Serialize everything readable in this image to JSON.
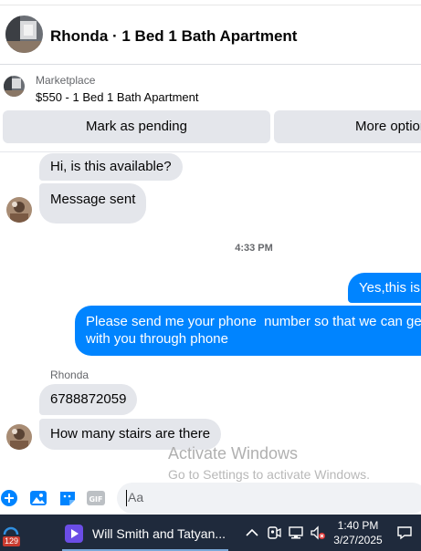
{
  "header": {
    "title": "Rhonda · 1 Bed 1 Bath Apartment"
  },
  "listing": {
    "source": "Marketplace",
    "price_title": "$550 - 1 Bed 1 Bath Apartment"
  },
  "actions": {
    "pending_label": "Mark as pending",
    "more_label": "More options"
  },
  "conversation": {
    "incoming_top": [
      "Hi, is this available?",
      "Message sent"
    ],
    "timestamp": "4:33 PM",
    "outgoing": [
      "Yes,this is still available",
      "Please send me your phone  number so that we can get\nwith you through phone"
    ],
    "sender_name": "Rhonda",
    "incoming_bottom": [
      "6788872059",
      "How many stairs are there"
    ]
  },
  "watermark": {
    "line1": "Activate Windows",
    "line2": "Go to Settings to activate Windows."
  },
  "composer": {
    "placeholder": "Aa",
    "icons": [
      "plus-circle-icon",
      "photo-icon",
      "sticker-icon",
      "gif-icon"
    ]
  },
  "taskbar": {
    "notification_count": "129",
    "app_label": "Will Smith and Tatyan...",
    "time": "1:40 PM",
    "date": "3/27/2025",
    "tray_icons": [
      "chevron-up-icon",
      "meet-now-icon",
      "network-icon",
      "volume-muted-icon",
      "notification-icon"
    ]
  },
  "colors": {
    "accent": "#0084ff",
    "bubble_in": "#e4e6eb",
    "taskbar": "#1f2a3c"
  }
}
